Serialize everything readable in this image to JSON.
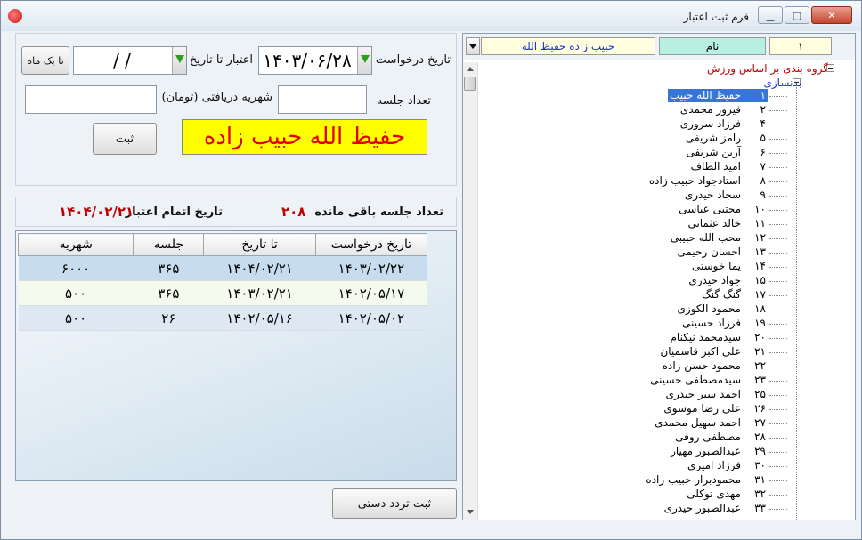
{
  "window": {
    "title": "فرم ثبت اعتبار",
    "buttons": [
      "minimize",
      "maximize",
      "close"
    ]
  },
  "form": {
    "request_date_label": "تاریخ درخواست",
    "request_date_value": "۱۴۰۳/۰۶/۲۸",
    "credit_until_label": "اعتبار تا تاریخ",
    "credit_until_value": "/ /",
    "one_month_button": "تا یک ماه",
    "sessions_label": "تعداد جلسه",
    "tuition_label": "شهریه دریافتی (تومان)",
    "sessions_value": "",
    "tuition_value": "",
    "submit_button": "ثبت",
    "member_name": "حفیظ الله  حبیب زاده"
  },
  "summary": {
    "remaining_label": "تعداد جلسه باقی مانده",
    "remaining_value": "۲۰۸",
    "expiry_label": "تاریخ اتمام اعتبار",
    "expiry_value": "۱۴۰۴/۰۲/۲۱"
  },
  "table": {
    "headers": [
      "شهریه",
      "جلسه",
      "تا تاریخ",
      "تاریخ درخواست"
    ],
    "rows": [
      [
        "۶۰۰۰",
        "۳۶۵",
        "۱۴۰۴/۰۲/۲۱",
        "۱۴۰۳/۰۲/۲۲"
      ],
      [
        "۵۰۰",
        "۳۶۵",
        "۱۴۰۳/۰۲/۲۱",
        "۱۴۰۲/۰۵/۱۷"
      ],
      [
        "۵۰۰",
        "۲۶",
        "۱۴۰۲/۰۵/۱۶",
        "۱۴۰۲/۰۵/۰۲"
      ]
    ]
  },
  "manual_attendance_button": "ثبت تردد دستی",
  "right_panel": {
    "id_value": "۱",
    "name_label": "نام",
    "name_value": "حبیب زاده    حفیظ الله",
    "tree_root": "گروه بندی بر اساس ورزش",
    "tree_group": "بدنسازی",
    "members": [
      {
        "num": "۱",
        "name": "حفیظ الله  حبیب زاده",
        "selected": true
      },
      {
        "num": "۲",
        "name": "فیروز  محمدی"
      },
      {
        "num": "۴",
        "name": "فرزاد  سروری"
      },
      {
        "num": "۵",
        "name": "رامز  شریفی"
      },
      {
        "num": "۶",
        "name": "آرین  شریفی"
      },
      {
        "num": "۷",
        "name": "امید  الطاف"
      },
      {
        "num": "۸",
        "name": "استادجواد  حبیب زاده"
      },
      {
        "num": "۹",
        "name": "سجاد  حیدری"
      },
      {
        "num": "۱۰",
        "name": "مجتبی  عباسی"
      },
      {
        "num": "۱۱",
        "name": "خالد  عثمانی"
      },
      {
        "num": "۱۲",
        "name": "محب الله  حبیبی"
      },
      {
        "num": "۱۳",
        "name": "احسان  رحیمی"
      },
      {
        "num": "۱۴",
        "name": "یما  خوستی"
      },
      {
        "num": "۱۵",
        "name": "جواد  حیدری"
      },
      {
        "num": "۱۷",
        "name": "گنگ  گنگ"
      },
      {
        "num": "۱۸",
        "name": "محمود  الکوزی"
      },
      {
        "num": "۱۹",
        "name": "فرزاد  حسینی"
      },
      {
        "num": "۲۰",
        "name": "سیدمحمد  نیکنام"
      },
      {
        "num": "۲۱",
        "name": "علی اکبر  قاسمیان"
      },
      {
        "num": "۲۲",
        "name": "محمود  حسن زاده"
      },
      {
        "num": "۲۳",
        "name": "سیدمصطفی  حسینی"
      },
      {
        "num": "۲۵",
        "name": "احمد سیر  حیدری"
      },
      {
        "num": "۲۶",
        "name": "علی رضا  موسوی"
      },
      {
        "num": "۲۷",
        "name": "احمد سهیل  محمدی"
      },
      {
        "num": "۲۸",
        "name": "مصطفی  روفی"
      },
      {
        "num": "۲۹",
        "name": "عبدالصبور  مهیار"
      },
      {
        "num": "۳۰",
        "name": "فرزاد  امیری"
      },
      {
        "num": "۳۱",
        "name": "محمودبرار  حبیب زاده"
      },
      {
        "num": "۳۲",
        "name": "مهدی  توکلی"
      },
      {
        "num": "۳۳",
        "name": "عبدالصبور  حیدری"
      }
    ]
  },
  "colors": {
    "accent_red": "#c00000",
    "banner_yellow": "#ffff00",
    "selection_blue": "#3875d7",
    "name_field_bg": "#ffffe0",
    "label_field_bg": "#b8f0e0"
  }
}
